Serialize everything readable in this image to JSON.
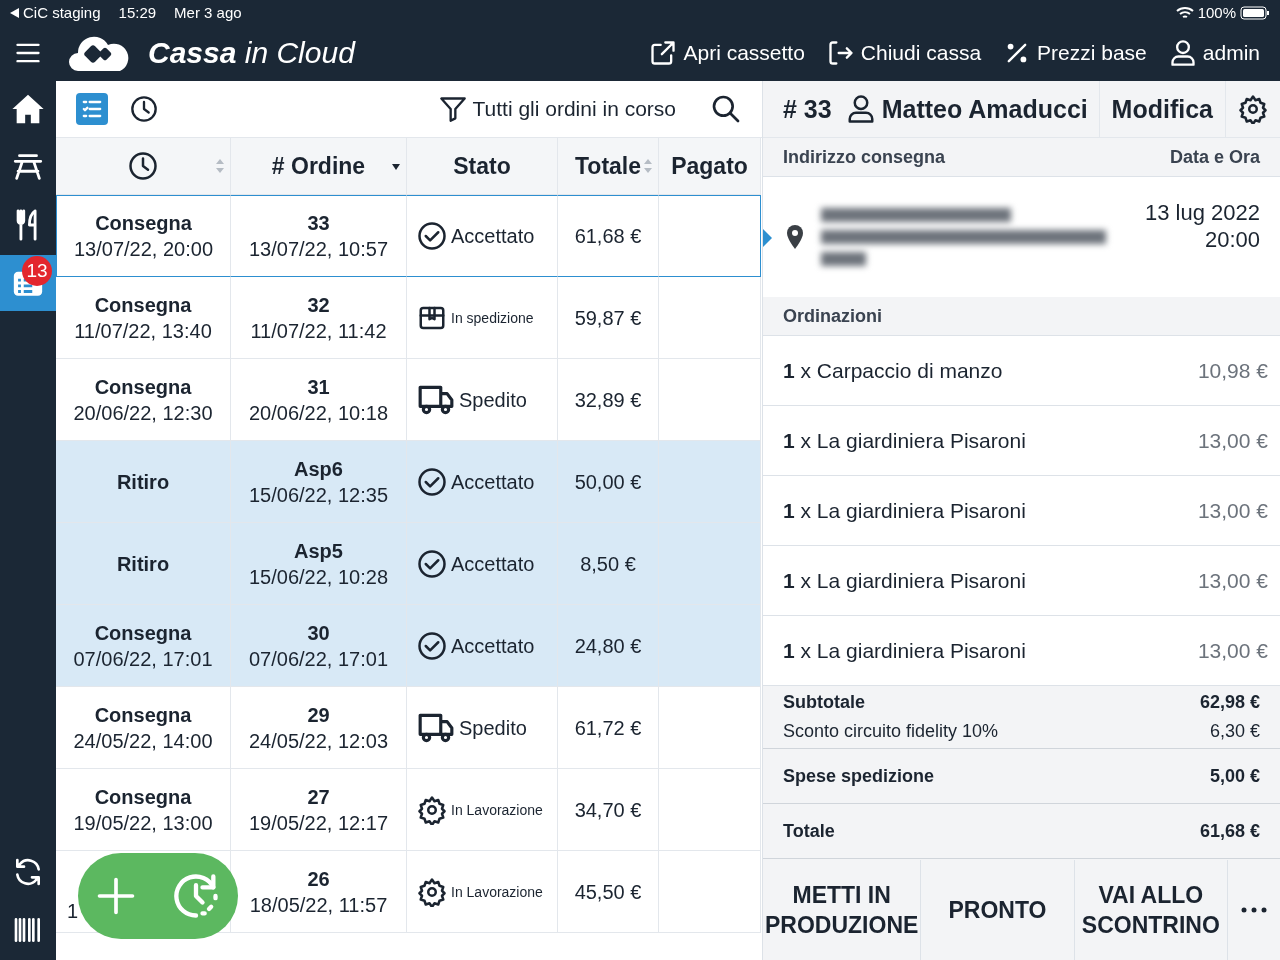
{
  "status_bar": {
    "back_app": "CiC staging",
    "time": "15:29",
    "date": "Mer 3 ago",
    "battery": "100%"
  },
  "header": {
    "brand": "**Cassa** in Cloud",
    "actions": [
      {
        "kind": "drawer",
        "label": "Apri cassetto"
      },
      {
        "kind": "exit",
        "label": "Chiudi cassa"
      },
      {
        "kind": "percent",
        "label": "Prezzi base"
      },
      {
        "kind": "user",
        "label": "admin"
      }
    ]
  },
  "sidebar": {
    "items": [
      {
        "kind": "home",
        "selected": false
      },
      {
        "kind": "table",
        "selected": false
      },
      {
        "kind": "cutlery",
        "selected": false
      },
      {
        "kind": "orders",
        "selected": true,
        "badge": "13"
      }
    ],
    "bottom_items": [
      {
        "kind": "sync"
      },
      {
        "kind": "barcode"
      }
    ]
  },
  "orders": {
    "views": [
      {
        "kind": "list",
        "selected": true
      },
      {
        "kind": "clock",
        "selected": false
      }
    ],
    "filter": "Tutti gli ordini in corso",
    "columns": [
      {
        "kind": "clock",
        "sortable": true,
        "sorted_desc": false
      },
      {
        "label": "# Ordine",
        "sortable": false,
        "sorted_desc": true
      },
      {
        "label": "Stato",
        "sortable": false,
        "sorted_desc": false
      },
      {
        "label": "Totale",
        "sortable": true,
        "sorted_desc": false
      },
      {
        "label": "Pagato",
        "sortable": false,
        "sorted_desc": false
      }
    ],
    "rows": [
      {
        "selected": true,
        "highlighted": false,
        "type": "Consegna",
        "due": "13/07/22, 20:00",
        "number": "33",
        "created": "13/07/22, 10:57",
        "status": {
          "kind": "accepted",
          "label": "Accettato"
        },
        "total": "61,68 €"
      },
      {
        "selected": false,
        "highlighted": false,
        "type": "Consegna",
        "due": "11/07/22, 13:40",
        "number": "32",
        "created": "11/07/22, 11:42",
        "status": {
          "kind": "shipping",
          "label": "In spedizione"
        },
        "total": "59,87 €"
      },
      {
        "selected": false,
        "highlighted": false,
        "type": "Consegna",
        "due": "20/06/22, 12:30",
        "number": "31",
        "created": "20/06/22, 10:18",
        "status": {
          "kind": "shipped",
          "label": "Spedito"
        },
        "total": "32,89 €"
      },
      {
        "selected": false,
        "highlighted": true,
        "type": "Ritiro",
        "number": "Asp6",
        "created": "15/06/22, 12:35",
        "status": {
          "kind": "accepted",
          "label": "Accettato"
        },
        "total": "50,00 €"
      },
      {
        "selected": false,
        "highlighted": true,
        "type": "Ritiro",
        "number": "Asp5",
        "created": "15/06/22, 10:28",
        "status": {
          "kind": "accepted",
          "label": "Accettato"
        },
        "total": "8,50 €"
      },
      {
        "selected": false,
        "highlighted": true,
        "type": "Consegna",
        "due": "07/06/22, 17:01",
        "number": "30",
        "created": "07/06/22, 17:01",
        "status": {
          "kind": "accepted",
          "label": "Accettato"
        },
        "total": "24,80 €"
      },
      {
        "selected": false,
        "highlighted": false,
        "type": "Consegna",
        "due": "24/05/22, 14:00",
        "number": "29",
        "created": "24/05/22, 12:03",
        "status": {
          "kind": "shipped",
          "label": "Spedito"
        },
        "total": "61,72 €"
      },
      {
        "selected": false,
        "highlighted": false,
        "type": "Consegna",
        "due": "19/05/22, 13:00",
        "number": "27",
        "created": "19/05/22, 12:17",
        "status": {
          "kind": "processing",
          "label": "In Lavorazione"
        },
        "total": "34,70 €"
      },
      {
        "selected": false,
        "highlighted": false,
        "covered": true,
        "due": "1",
        "number": "26",
        "created": "18/05/22, 11:57",
        "status": {
          "kind": "processing",
          "label": "In Lavorazione"
        },
        "total": "45,50 €"
      }
    ]
  },
  "detail": {
    "number": "# 33",
    "customer": "Matteo Amaducci",
    "edit": "Modifica",
    "address_heading": "Indirizzo consegna",
    "datetime_heading": "Data e Ora",
    "delivery_date": "13 lug 2022",
    "delivery_time": "20:00",
    "items_heading": "Ordinazioni",
    "items": [
      {
        "label": "**1** x Carpaccio di manzo",
        "price": "10,98 €"
      },
      {
        "label": "**1** x La giardiniera Pisaroni",
        "price": "13,00 €"
      },
      {
        "label": "**1** x La giardiniera Pisaroni",
        "price": "13,00 €"
      },
      {
        "label": "**1** x La giardiniera Pisaroni",
        "price": "13,00 €"
      },
      {
        "label": "**1** x La giardiniera Pisaroni",
        "price": "13,00 €"
      }
    ],
    "subtotal_label": "Subtotale",
    "subtotal": "62,98 €",
    "discount_label": "Sconto circuito fidelity 10%",
    "discount": "6,30 €",
    "shipping_label": "Spese spedizione",
    "shipping": "5,00 €",
    "total_label": "Totale",
    "total": "61,68 €",
    "actions": [
      "METTI IN PRODUZIONE",
      "PRONTO",
      "VAI ALLO SCONTRINO"
    ]
  }
}
